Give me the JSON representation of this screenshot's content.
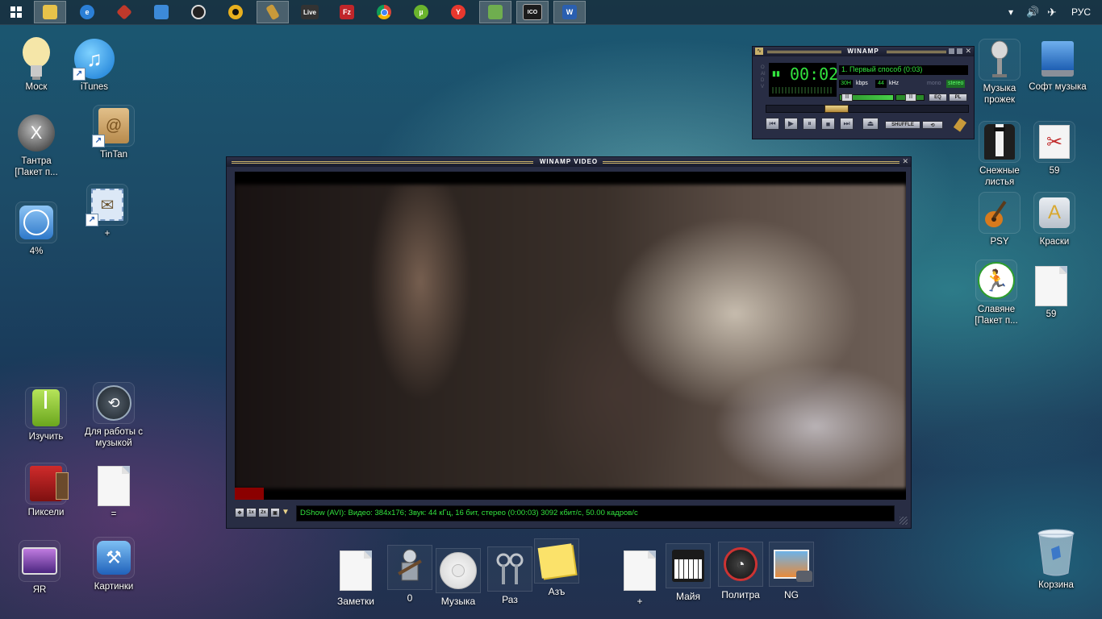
{
  "taskbar": {
    "start_label": "Start",
    "apps": [
      {
        "name": "file-explorer",
        "glyph": "",
        "color": "#e8c24a"
      },
      {
        "name": "internet-explorer",
        "glyph": "e",
        "color": "#2b7fd6"
      },
      {
        "name": "app-red",
        "glyph": "",
        "color": "#c0392b"
      },
      {
        "name": "app-blue",
        "glyph": "",
        "color": "#3c8ad8"
      },
      {
        "name": "app-media",
        "glyph": "",
        "color": "#222222"
      },
      {
        "name": "app-ring",
        "glyph": "",
        "color": "#e8b01e"
      },
      {
        "name": "winamp",
        "glyph": "",
        "color": "#c89a3a"
      },
      {
        "name": "live",
        "glyph": "Live",
        "color": "#333333"
      },
      {
        "name": "filezilla",
        "glyph": "Fz",
        "color": "#c0262a"
      },
      {
        "name": "chrome",
        "glyph": "",
        "color": "#3aa757"
      },
      {
        "name": "utorrent",
        "glyph": "µ",
        "color": "#6ab42d"
      },
      {
        "name": "yandex-browser",
        "glyph": "Y",
        "color": "#e8382e"
      },
      {
        "name": "app-images",
        "glyph": "",
        "color": "#6fae4f"
      },
      {
        "name": "ico-tool",
        "glyph": "ICO",
        "color": "#1c1c1c"
      },
      {
        "name": "word",
        "glyph": "W",
        "color": "#2a5fb0"
      }
    ],
    "tray": {
      "chevron": "▾",
      "volume": "🔊",
      "airplane": "✈",
      "language": "РУС"
    }
  },
  "desktop_icons": [
    {
      "name": "moscow",
      "label": "Моск"
    },
    {
      "name": "itunes",
      "label": "iTunes"
    },
    {
      "name": "tantra",
      "label": "Тантра [Пакет п..."
    },
    {
      "name": "tintan",
      "label": "TinTan"
    },
    {
      "name": "percent",
      "label": "4%"
    },
    {
      "name": "plus",
      "label": "+"
    },
    {
      "name": "study",
      "label": "Изучить"
    },
    {
      "name": "music-work",
      "label": "Для работы с музыкой"
    },
    {
      "name": "pixels",
      "label": "Пиксели"
    },
    {
      "name": "equals",
      "label": "="
    },
    {
      "name": "ya",
      "label": "ЯR"
    },
    {
      "name": "pictures",
      "label": "Картинки"
    },
    {
      "name": "music-proj",
      "label": "Музыка прожек"
    },
    {
      "name": "soft-music",
      "label": "Софт музыка"
    },
    {
      "name": "snow-leaves",
      "label": "Снежные листья"
    },
    {
      "name": "fifty-nine-a",
      "label": "59"
    },
    {
      "name": "psy",
      "label": "PSY"
    },
    {
      "name": "paints",
      "label": "Краски"
    },
    {
      "name": "slavs",
      "label": "Славяне [Пакет п..."
    },
    {
      "name": "fifty-nine-b",
      "label": "59"
    },
    {
      "name": "recycle-bin",
      "label": "Корзина"
    }
  ],
  "winamp": {
    "title": "WINAMP",
    "time": "00:02",
    "track": "1. Первый способ (0:03)",
    "kbps_value": "30H",
    "kbps_label": "kbps",
    "khz_value": "44",
    "khz_label": "kHz",
    "mono": "mono",
    "stereo": "stereo",
    "eq_label": "EQ",
    "pl_label": "PL",
    "shuffle": "SHUFFLE",
    "side_letters": "OAIDV"
  },
  "winamp_video": {
    "title": "WINAMP VIDEO",
    "status": "DShow (AVI): Видео: 384x176; Звук: 44 кГц, 16 бит, стерео (0:00:03) 3092 кбит/с, 50.00 кадров/с",
    "zoom_1x": "1x",
    "zoom_2x": "2x"
  },
  "dock": [
    {
      "name": "notes",
      "label": "Заметки"
    },
    {
      "name": "zero",
      "label": "0"
    },
    {
      "name": "music",
      "label": "Музыка"
    },
    {
      "name": "raz",
      "label": "Раз"
    },
    {
      "name": "az",
      "label": "Азъ"
    },
    {
      "name": "plus2",
      "label": "+"
    },
    {
      "name": "mayya",
      "label": "Майя"
    },
    {
      "name": "polytra",
      "label": "Политра"
    },
    {
      "name": "ng",
      "label": "NG"
    }
  ]
}
